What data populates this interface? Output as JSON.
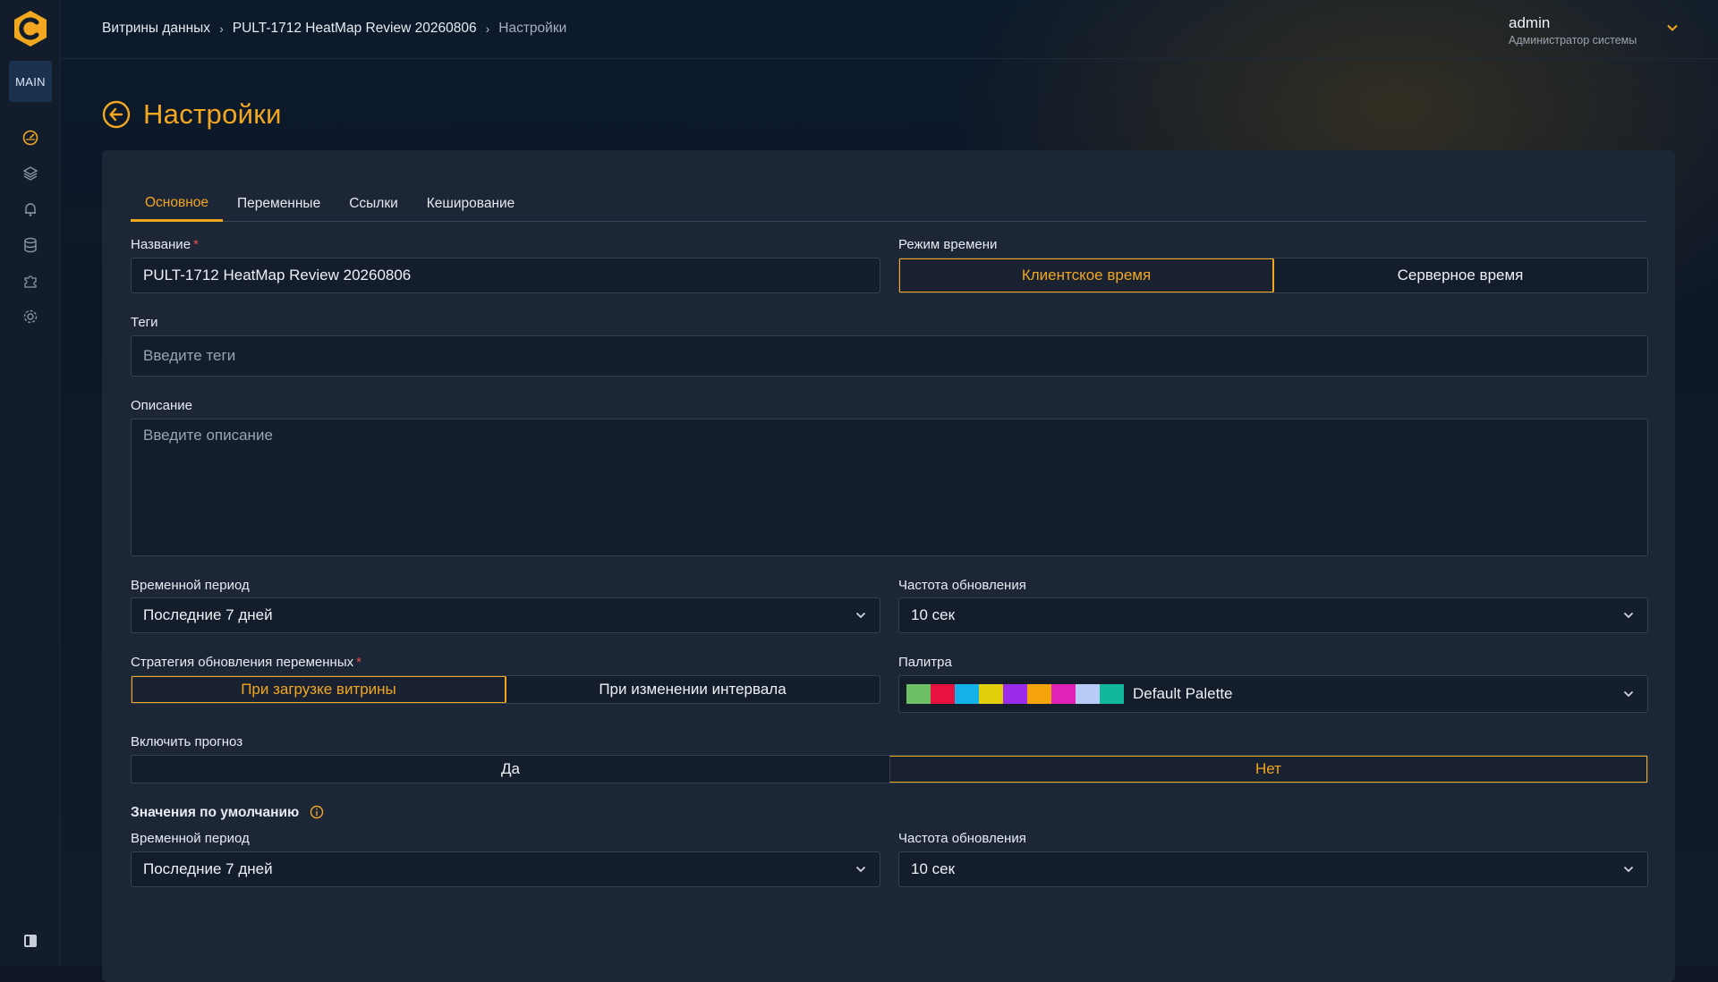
{
  "sidebar": {
    "main_label": "MAIN",
    "icons": [
      "dashboard-icon",
      "layers-icon",
      "bell-icon",
      "database-icon",
      "puzzle-icon",
      "gear-icon"
    ]
  },
  "breadcrumb": {
    "items": [
      "Витрины данных",
      "PULT-1712 HeatMap Review 20260806",
      "Настройки"
    ]
  },
  "user": {
    "name": "admin",
    "role": "Администратор системы"
  },
  "page": {
    "title": "Настройки"
  },
  "tabs": [
    "Основное",
    "Переменные",
    "Ссылки",
    "Кеширование"
  ],
  "form": {
    "name_label": "Название",
    "name_value": "PULT-1712 HeatMap Review 20260806",
    "time_mode_label": "Режим времени",
    "time_mode_options": [
      "Клиентское время",
      "Серверное время"
    ],
    "time_mode_selected": "Клиентское время",
    "tags_label": "Теги",
    "tags_placeholder": "Введите теги",
    "description_label": "Описание",
    "description_placeholder": "Введите описание",
    "period_label": "Временной период",
    "period_value": "Последние 7 дней",
    "refresh_label": "Частота обновления",
    "refresh_value": "10 сек",
    "strategy_label": "Стратегия обновления переменных",
    "strategy_options": [
      "При загрузке витрины",
      "При изменении интервала"
    ],
    "strategy_selected": "При загрузке витрины",
    "palette_label": "Палитра",
    "palette_value": "Default Palette",
    "palette_colors": [
      "#6dbf63",
      "#e8123f",
      "#15b1ea",
      "#e2cf0c",
      "#9c2bea",
      "#f5a40c",
      "#e022b8",
      "#b7cdf5",
      "#11b99a"
    ],
    "forecast_label": "Включить прогноз",
    "forecast_options": [
      "Да",
      "Нет"
    ],
    "forecast_selected": "Нет",
    "defaults_heading": "Значения по умолчанию",
    "default_period_label": "Временной период",
    "default_period_value": "Последние 7 дней",
    "default_refresh_label": "Частота обновления",
    "default_refresh_value": "10 сек"
  },
  "colors": {
    "accent": "#f2a720",
    "panel": "#1d2637",
    "field": "#141d2c",
    "required": "#e0524e"
  }
}
